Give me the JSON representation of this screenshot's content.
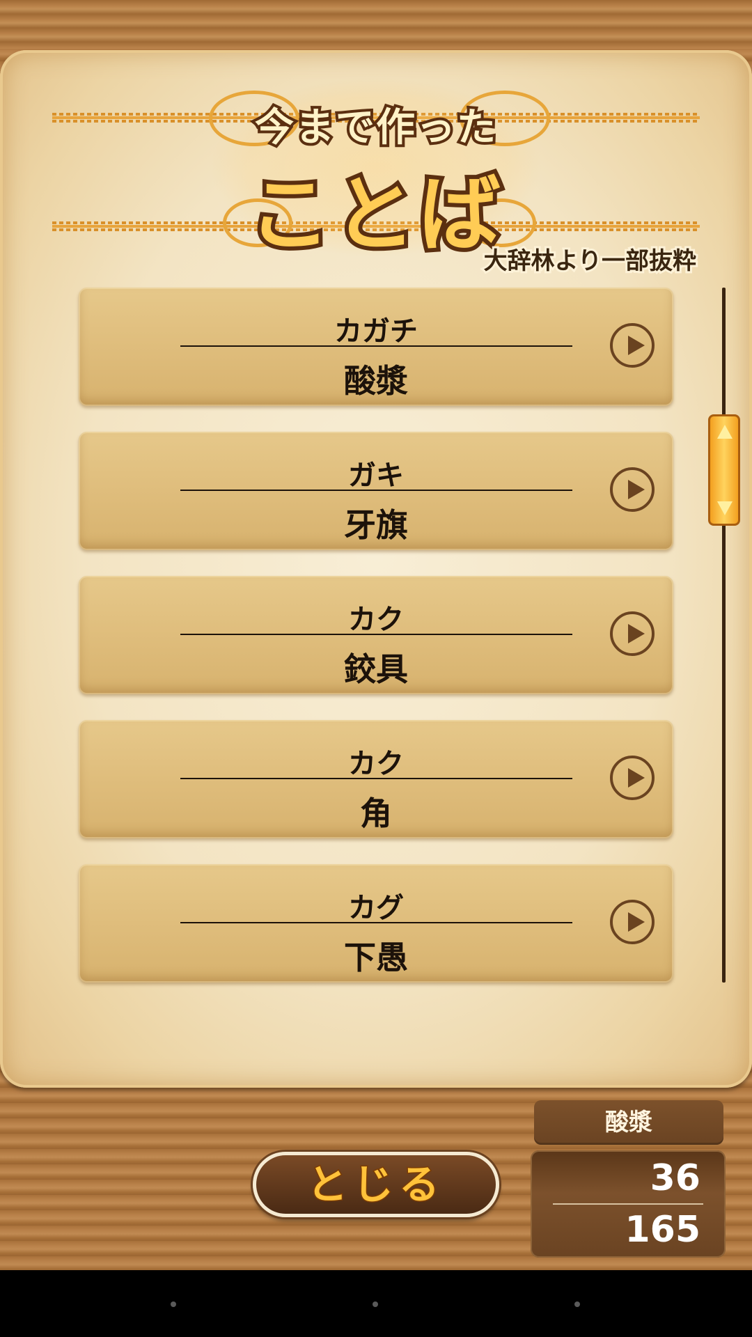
{
  "title": {
    "small": "今まで作った",
    "big": "ことば",
    "subtitle": "大辞林より一部抜粋"
  },
  "entries": [
    {
      "reading": "カガチ",
      "word": "酸漿"
    },
    {
      "reading": "ガキ",
      "word": "牙旗"
    },
    {
      "reading": "カク",
      "word": "鉸具"
    },
    {
      "reading": "カク",
      "word": "角"
    },
    {
      "reading": "カグ",
      "word": "下愚"
    }
  ],
  "footer": {
    "close_label": "とじる",
    "selected_word": "酸漿",
    "current_count": "36",
    "total_count": "165"
  },
  "colors": {
    "wood": "#b9814a",
    "parchment": "#f3e4c3",
    "card": "#dfbd7c",
    "title_fill": "#ffcc55",
    "scroll_thumb": "#f3a020"
  }
}
